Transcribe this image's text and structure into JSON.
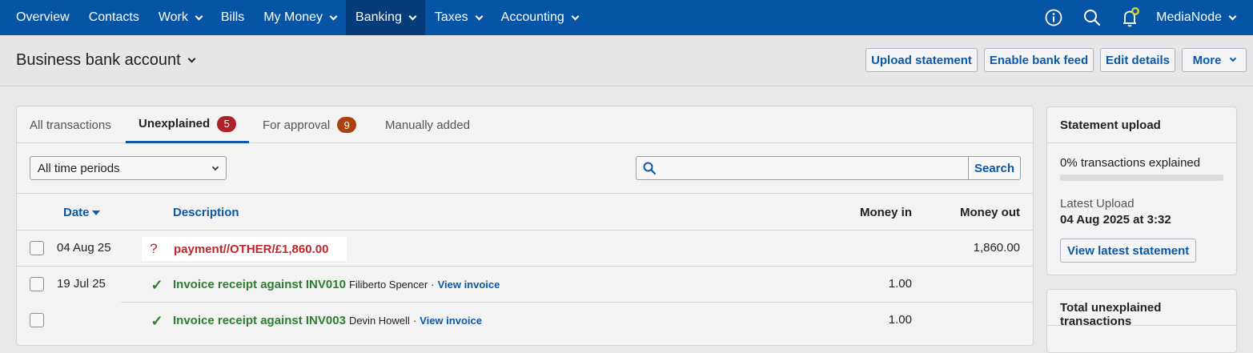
{
  "nav": {
    "items": [
      {
        "label": "Overview",
        "dropdown": false,
        "active": false
      },
      {
        "label": "Contacts",
        "dropdown": false,
        "active": false
      },
      {
        "label": "Work",
        "dropdown": true,
        "active": false
      },
      {
        "label": "Bills",
        "dropdown": false,
        "active": false
      },
      {
        "label": "My Money",
        "dropdown": true,
        "active": false
      },
      {
        "label": "Banking",
        "dropdown": true,
        "active": true
      },
      {
        "label": "Taxes",
        "dropdown": true,
        "active": false
      },
      {
        "label": "Accounting",
        "dropdown": true,
        "active": false
      }
    ],
    "icons": [
      "info-icon",
      "search-icon",
      "bell-icon"
    ],
    "user": "MediaNode"
  },
  "header": {
    "title": "Business bank account",
    "buttons": {
      "upload": "Upload statement",
      "feed": "Enable bank feed",
      "edit": "Edit details",
      "more": "More"
    }
  },
  "tabs": [
    {
      "label": "All transactions",
      "badge": ""
    },
    {
      "label": "Unexplained",
      "badge": "5"
    },
    {
      "label": "For approval",
      "badge": "9"
    },
    {
      "label": "Manually added",
      "badge": ""
    }
  ],
  "filters": {
    "period": "All time periods",
    "search_placeholder": "",
    "search_button": "Search"
  },
  "table": {
    "headers": {
      "date": "Date",
      "description": "Description",
      "money_in": "Money in",
      "money_out": "Money out"
    },
    "rows": [
      {
        "date": "04 Aug 25",
        "status": "?",
        "description": "payment//OTHER/£1,860.00",
        "contact": "",
        "link": "",
        "money_in": "",
        "money_out": "1,860.00"
      },
      {
        "date": "19 Jul 25",
        "status": "✓",
        "description": "Invoice receipt against INV010",
        "contact": "Filiberto Spencer",
        "link": "View invoice",
        "money_in": "1.00",
        "money_out": ""
      },
      {
        "date": "",
        "status": "✓",
        "description": "Invoice receipt against INV003",
        "contact": "Devin Howell",
        "link": "View invoice",
        "money_in": "1.00",
        "money_out": ""
      }
    ],
    "separator": "·"
  },
  "statement_upload": {
    "title": "Statement upload",
    "percent_text": "0% transactions explained",
    "percent": 0,
    "latest_label": "Latest Upload",
    "latest_value": "04 Aug 2025 at 3:32",
    "button": "View latest statement"
  },
  "total_unexplained": {
    "title": "Total unexplained transactions"
  },
  "colors": {
    "nav_bg": "#0654a6",
    "nav_active": "#063c7a",
    "link": "#0b58a8",
    "badge_unexplained": "#b0202a",
    "badge_approval": "#a8420f",
    "error_red": "#c0262b",
    "success_green": "#2e7d32"
  }
}
